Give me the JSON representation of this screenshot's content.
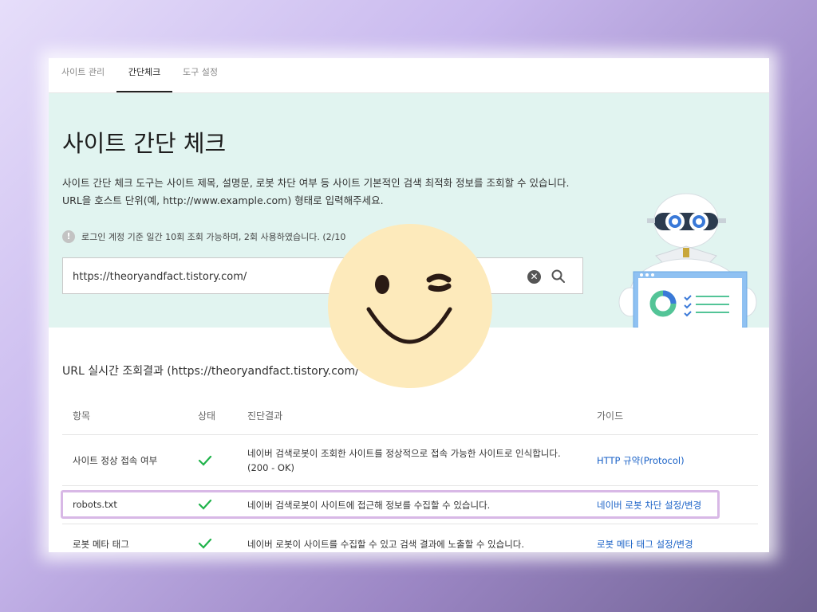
{
  "tabs": [
    {
      "label": "사이트 관리",
      "active": false
    },
    {
      "label": "간단체크",
      "active": true
    },
    {
      "label": "도구 설정",
      "active": false
    }
  ],
  "hero": {
    "title": "사이트 간단 체크",
    "desc_line1": "사이트 간단 체크 도구는 사이트 제목, 설명문, 로봇 차단 여부 등 사이트 기본적인 검색 최적화 정보를 조회할 수 있습니다.",
    "desc_line2": "URL을 호스트 단위(예, http://www.example.com) 형태로 입력해주세요.",
    "notice": "로그인 계정 기준 일간 10회 조회 가능하며, 2회 사용하였습니다. (2/10"
  },
  "search": {
    "value": "https://theoryandfact.tistory.com/",
    "clear_icon": "clear-circle-icon",
    "search_icon": "magnifier-icon"
  },
  "results": {
    "title": "URL 실시간 조회결과 (https://theoryandfact.tistory.com/",
    "headers": {
      "item": "항목",
      "status": "상태",
      "result": "진단결과",
      "guide": "가이드"
    },
    "rows": [
      {
        "item": "사이트 정상 접속 여부",
        "status": "ok",
        "result_line1": "네이버 검색로봇이 조회한 사이트를 정상적으로 접속 가능한 사이트로 인식합니다.",
        "result_line2": "(200 - OK)",
        "guide": "HTTP 규약(Protocol)"
      },
      {
        "item": "robots.txt",
        "status": "ok",
        "result_line1": "네이버 검색로봇이 사이트에 접근해 정보를 수집할 수 있습니다.",
        "guide": "네이버 로봇 차단 설정/변경"
      },
      {
        "item": "로봇 메타 태그",
        "status": "ok",
        "result_line1": "네이버 로봇이 사이트를 수집할 수 있고 검색 결과에 노출할 수 있습니다.",
        "guide": "로봇 메타 태그 설정/변경"
      }
    ]
  },
  "colors": {
    "hero_bg": "#e1f4f0",
    "check_green": "#1fb34a",
    "link_blue": "#1a62c7",
    "highlight_border": "#d8b8e6",
    "emoji_face": "#fdeabb"
  }
}
